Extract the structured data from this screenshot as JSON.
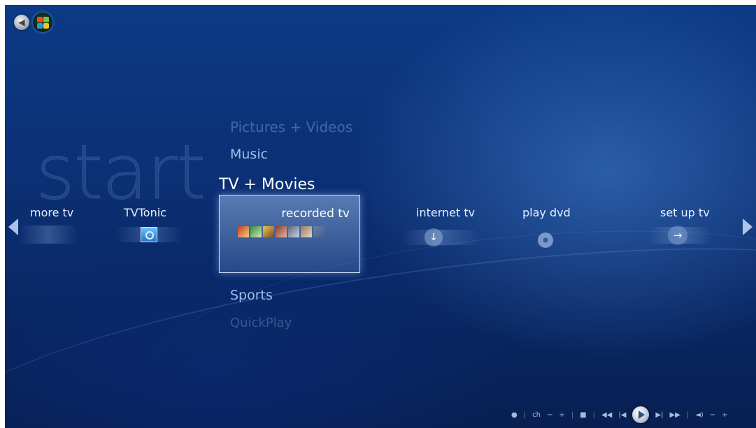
{
  "watermark": "start",
  "menu": {
    "categories": {
      "faded_top": "Pictures + Videos",
      "above": "Music",
      "active": "TV + Movies",
      "below": "Sports",
      "faded_bottom": "QuickPlay"
    },
    "strip": [
      {
        "label": "more tv"
      },
      {
        "label": "TVTonic"
      },
      {
        "label": "recorded tv"
      },
      {
        "label": "internet tv"
      },
      {
        "label": "play dvd"
      },
      {
        "label": "set up tv"
      }
    ]
  },
  "transport": {
    "ch_label": "ch"
  },
  "icons": {
    "back": "back-arrow-icon",
    "start": "windows-orb-icon",
    "prev": "chevron-left-icon",
    "next": "chevron-right-icon",
    "play": "play-icon"
  },
  "colors": {
    "background": "#0b2f73",
    "highlight_text": "#ffffff",
    "menu_text": "#9cc0ee"
  }
}
